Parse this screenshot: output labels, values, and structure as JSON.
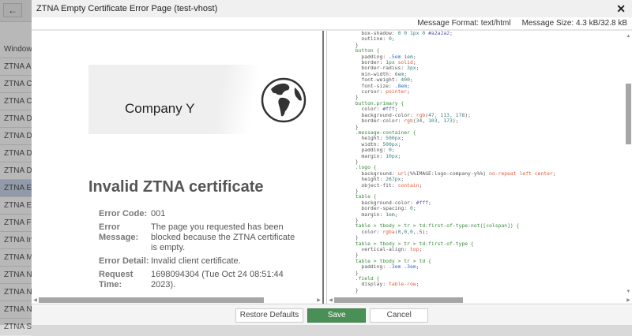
{
  "background": {
    "back_icon": "←",
    "list_items": [
      "Window",
      "ZTNA Au",
      "ZTNA Ca",
      "ZTNA Cl",
      "ZTNA De",
      "ZTNA De",
      "ZTNA De",
      "ZTNA De",
      "ZTNA Em",
      "ZTNA Em",
      "ZTNA FC",
      "ZTNA In",
      "ZTNA M",
      "ZTNA No",
      "ZTNA No",
      "ZTNA No",
      "ZTNA SS"
    ],
    "selected_index": 8
  },
  "dialog": {
    "title": "ZTNA Empty Certificate Error Page (test-vhost)",
    "close_icon": "✕",
    "message_format": "Message Format: text/html",
    "message_size": "Message Size: 4.3 kB/32.8 kB"
  },
  "preview": {
    "logo_text": "Company Y",
    "heading": "Invalid ZTNA certificate",
    "rows": [
      {
        "label": "Error Code:",
        "value": "001"
      },
      {
        "label": "Error Message:",
        "value": "The page you requested has been blocked because the ZTNA certificate is empty."
      },
      {
        "label": "Error Detail:",
        "value": "Invalid client certificate."
      },
      {
        "label": "Request Time:",
        "value": "1698094304 (Tue Oct 24 08:51:44 2023)."
      }
    ]
  },
  "editor": {
    "lines": [
      "    box-shadow: 0 0 1px 0 #a2a2a2;",
      "    outline: 0;",
      "  }",
      "  button {",
      "    padding: .5em 1em;",
      "    border: 1px solid;",
      "    border-radius: 3px;",
      "    min-width: 6em;",
      "    font-weight: 400;",
      "    font-size: .8em;",
      "    cursor: pointer;",
      "  }",
      "  button.primary {",
      "    color: #fff;",
      "    background-color: rgb(47, 113, 178);",
      "    border-color: rgb(34, 103, 173);",
      "  }",
      "  .message-container {",
      "    height: 500px;",
      "    width: 500px;",
      "    padding: 0;",
      "    margin: 10px;",
      "  }",
      "  .logo {",
      "    background: url(%%IMAGE:logo-company-y%%) no-repeat left center;",
      "    height: 267px;",
      "    object-fit: contain;",
      "  }",
      "  table {",
      "    background-color: #fff;",
      "    border-spacing: 0;",
      "    margin: 1em;",
      "  }",
      "  table > tbody > tr > td:first-of-type:not([colspan]) {",
      "    color: rgba(0,0,0,.5);",
      "  }",
      "  table > tbody > tr > td:first-of-type {",
      "    vertical-align: top;",
      "  }",
      "  table > tbody > tr > td {",
      "    padding: .3em .3em;",
      "  }",
      "  .field {",
      "    display: table-row;",
      "  }"
    ]
  },
  "footer": {
    "restore_label": "Restore Defaults",
    "save_label": "Save",
    "cancel_label": "Cancel"
  }
}
